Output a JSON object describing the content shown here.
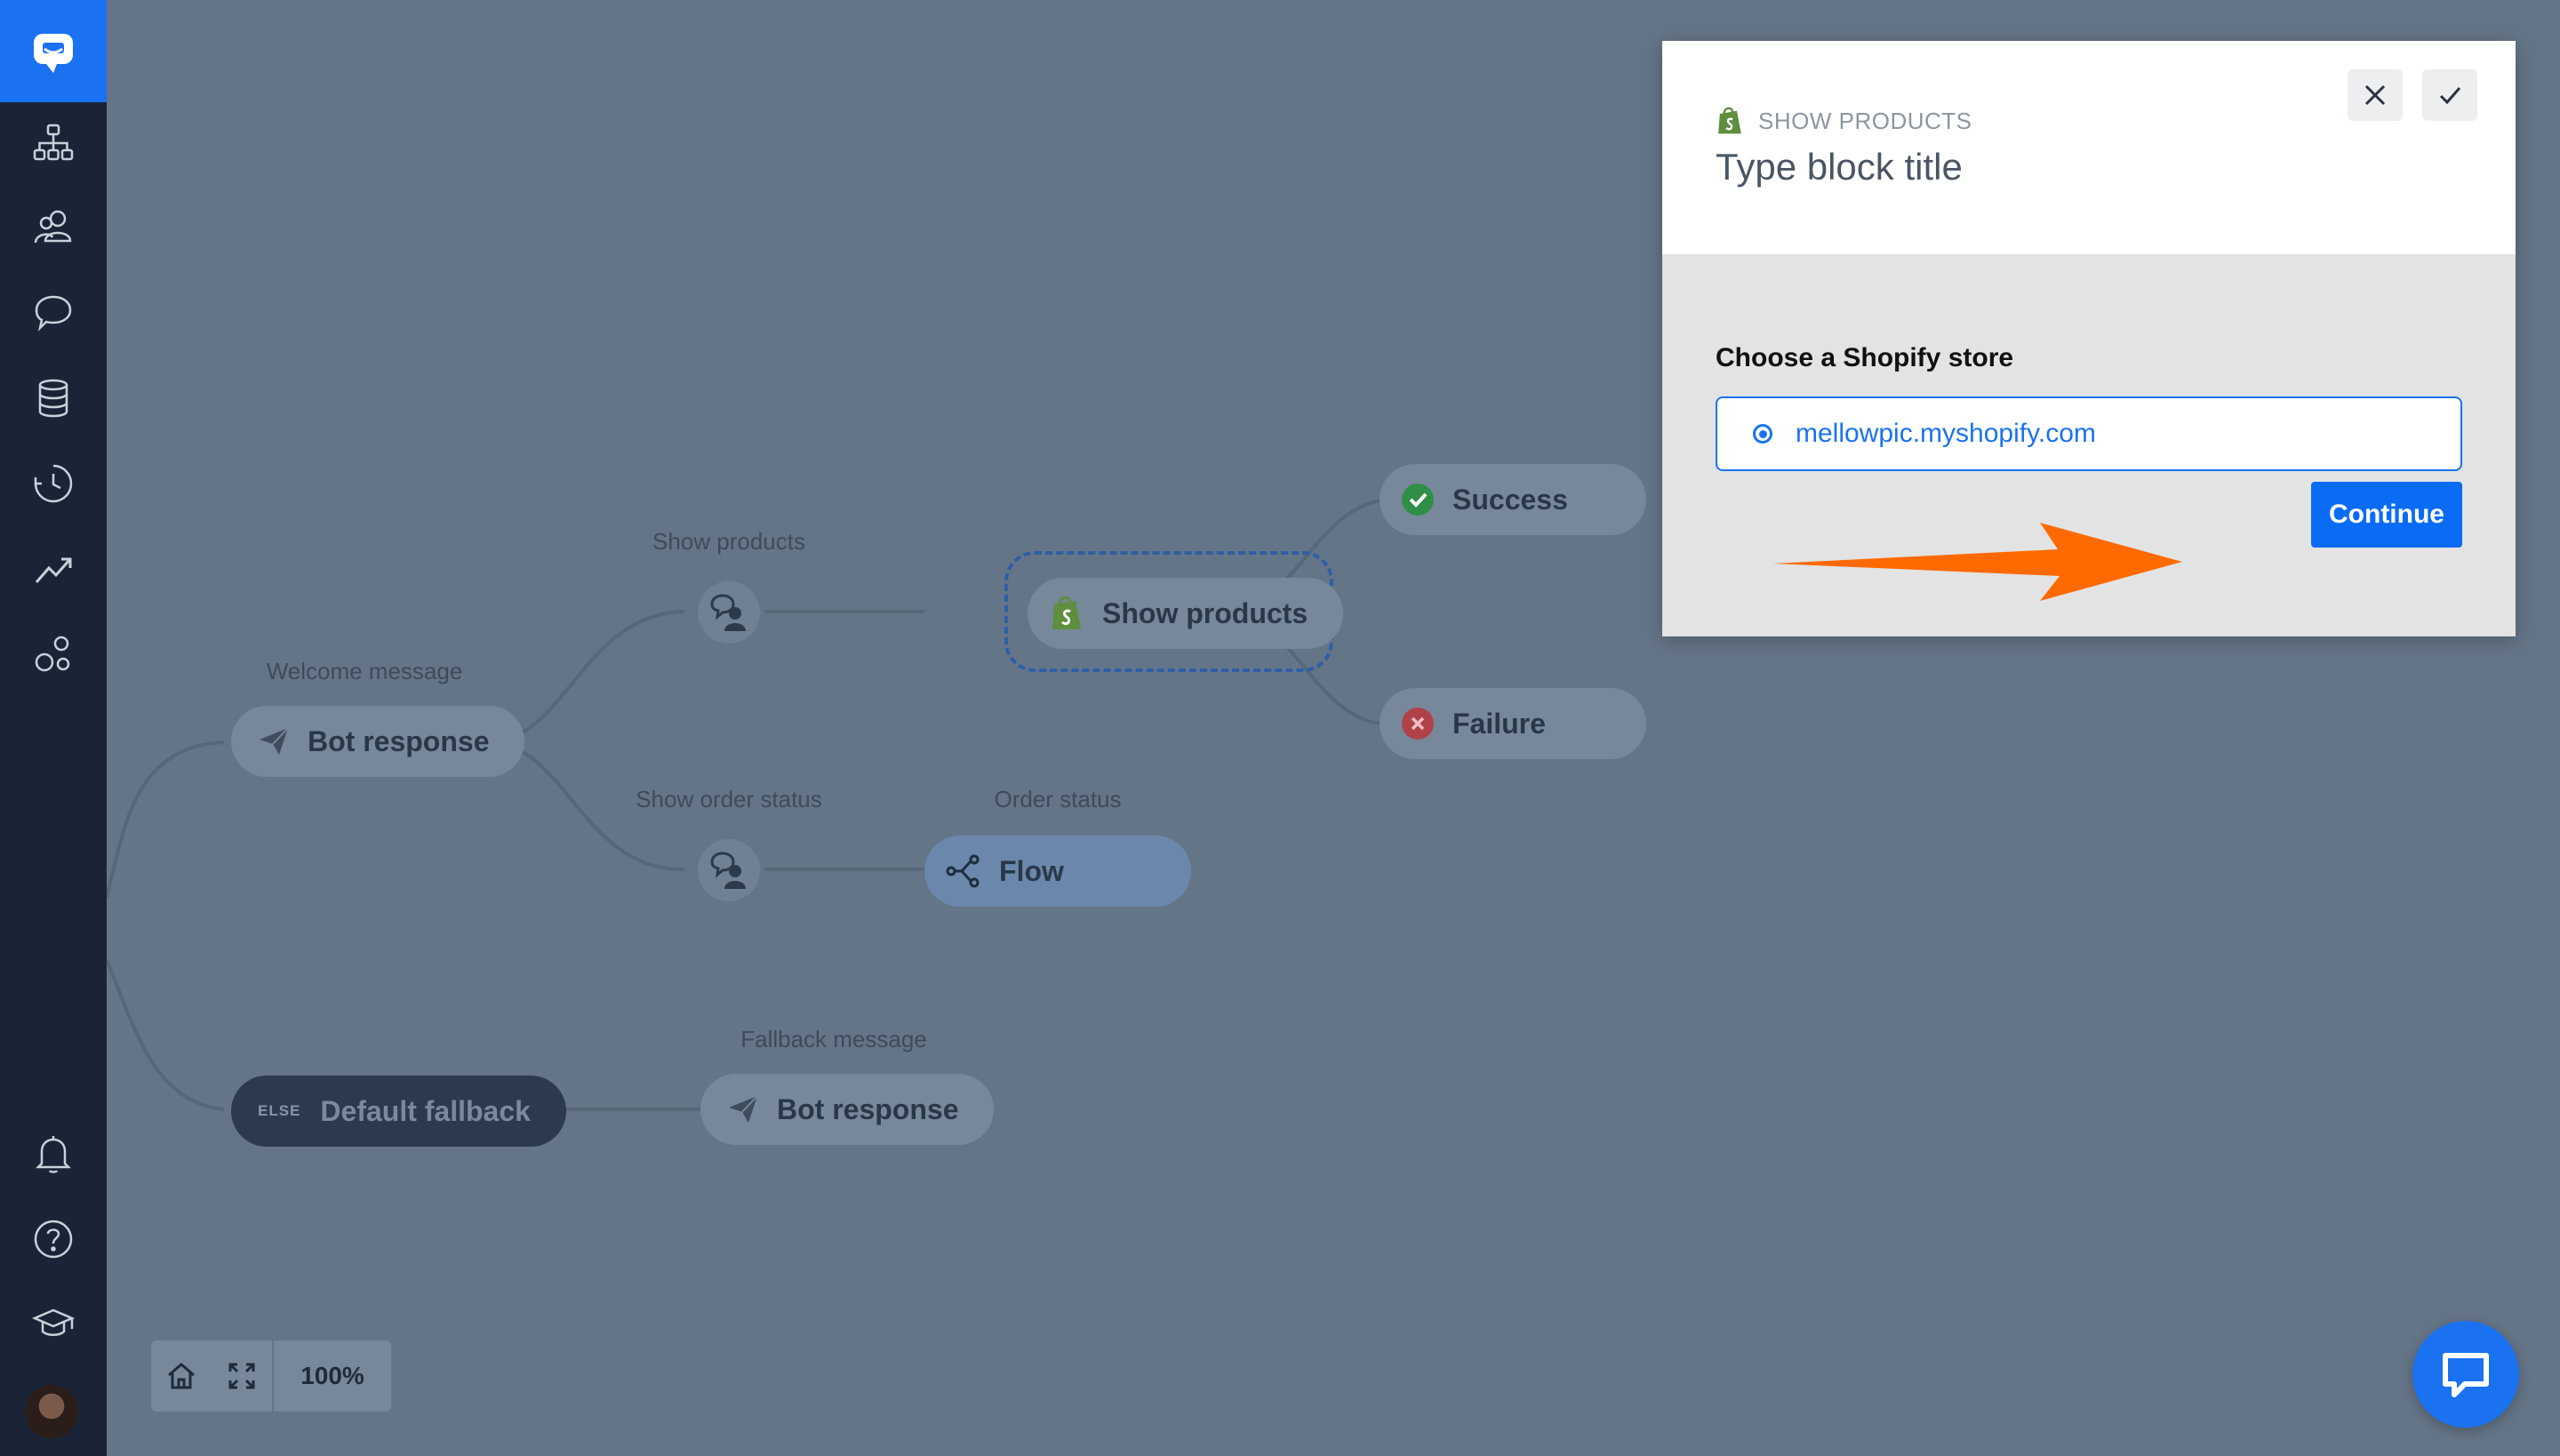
{
  "colors": {
    "sidebar_bg": "#1a2436",
    "brand_blue": "#1a72f0",
    "overlay_canvas": "#647587",
    "arrow_orange": "#ff6a00",
    "success_green": "#2f8f46",
    "failure_red": "#b0424a",
    "shopify_green": "#5e8e3e"
  },
  "sidebar": {
    "items": [
      {
        "icon": "flows-icon"
      },
      {
        "icon": "users-icon"
      },
      {
        "icon": "chat-bubbles-icon"
      },
      {
        "icon": "database-icon"
      },
      {
        "icon": "history-icon"
      },
      {
        "icon": "analytics-icon"
      },
      {
        "icon": "integrations-icon"
      }
    ],
    "bottom_items": [
      {
        "icon": "bell-icon"
      },
      {
        "icon": "help-icon"
      },
      {
        "icon": "academy-icon"
      }
    ]
  },
  "canvas": {
    "welcome_label": "Welcome message",
    "welcome_node": "Bot response",
    "show_products_label": "Show products",
    "show_products_node": "Show products",
    "show_order_status_label": "Show order status",
    "order_status_label": "Order status",
    "flow_node": "Flow",
    "success_node": "Success",
    "failure_node": "Failure",
    "fallback_tag": "ELSE",
    "fallback_node": "Default fallback",
    "fallback_label": "Fallback message",
    "fallback_response_node": "Bot response"
  },
  "zoom": {
    "value": "100%"
  },
  "modal": {
    "kind": "SHOW PRODUCTS",
    "title": "Type block title",
    "store_label": "Choose a Shopify store",
    "store_option": "mellowpic.myshopify.com",
    "continue_label": "Continue"
  }
}
